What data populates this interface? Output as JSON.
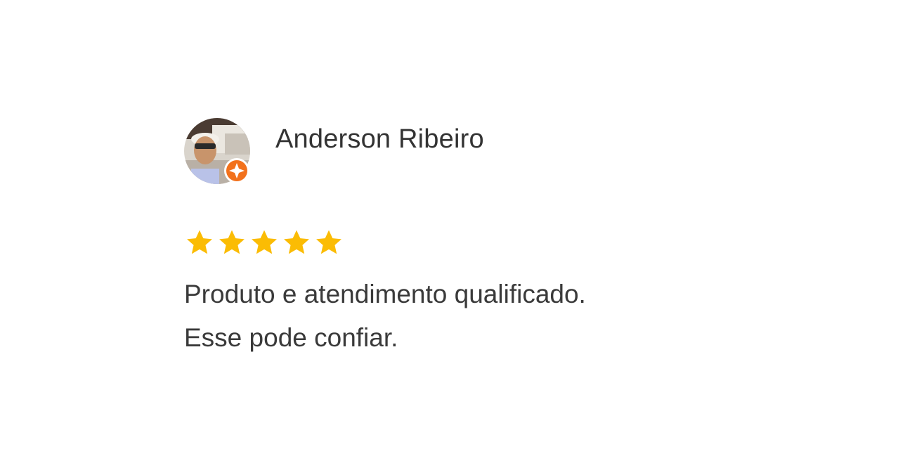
{
  "review": {
    "reviewer": {
      "name": "Anderson Ribeiro",
      "avatar_icon": "user-photo-avatar",
      "badge_icon": "local-guide-badge-icon",
      "badge_color": "#f2711c"
    },
    "rating": {
      "value": 5,
      "max": 5,
      "star_color": "#fbbc04"
    },
    "text": "Produto e atendimento qualificado.\nEsse pode confiar."
  }
}
